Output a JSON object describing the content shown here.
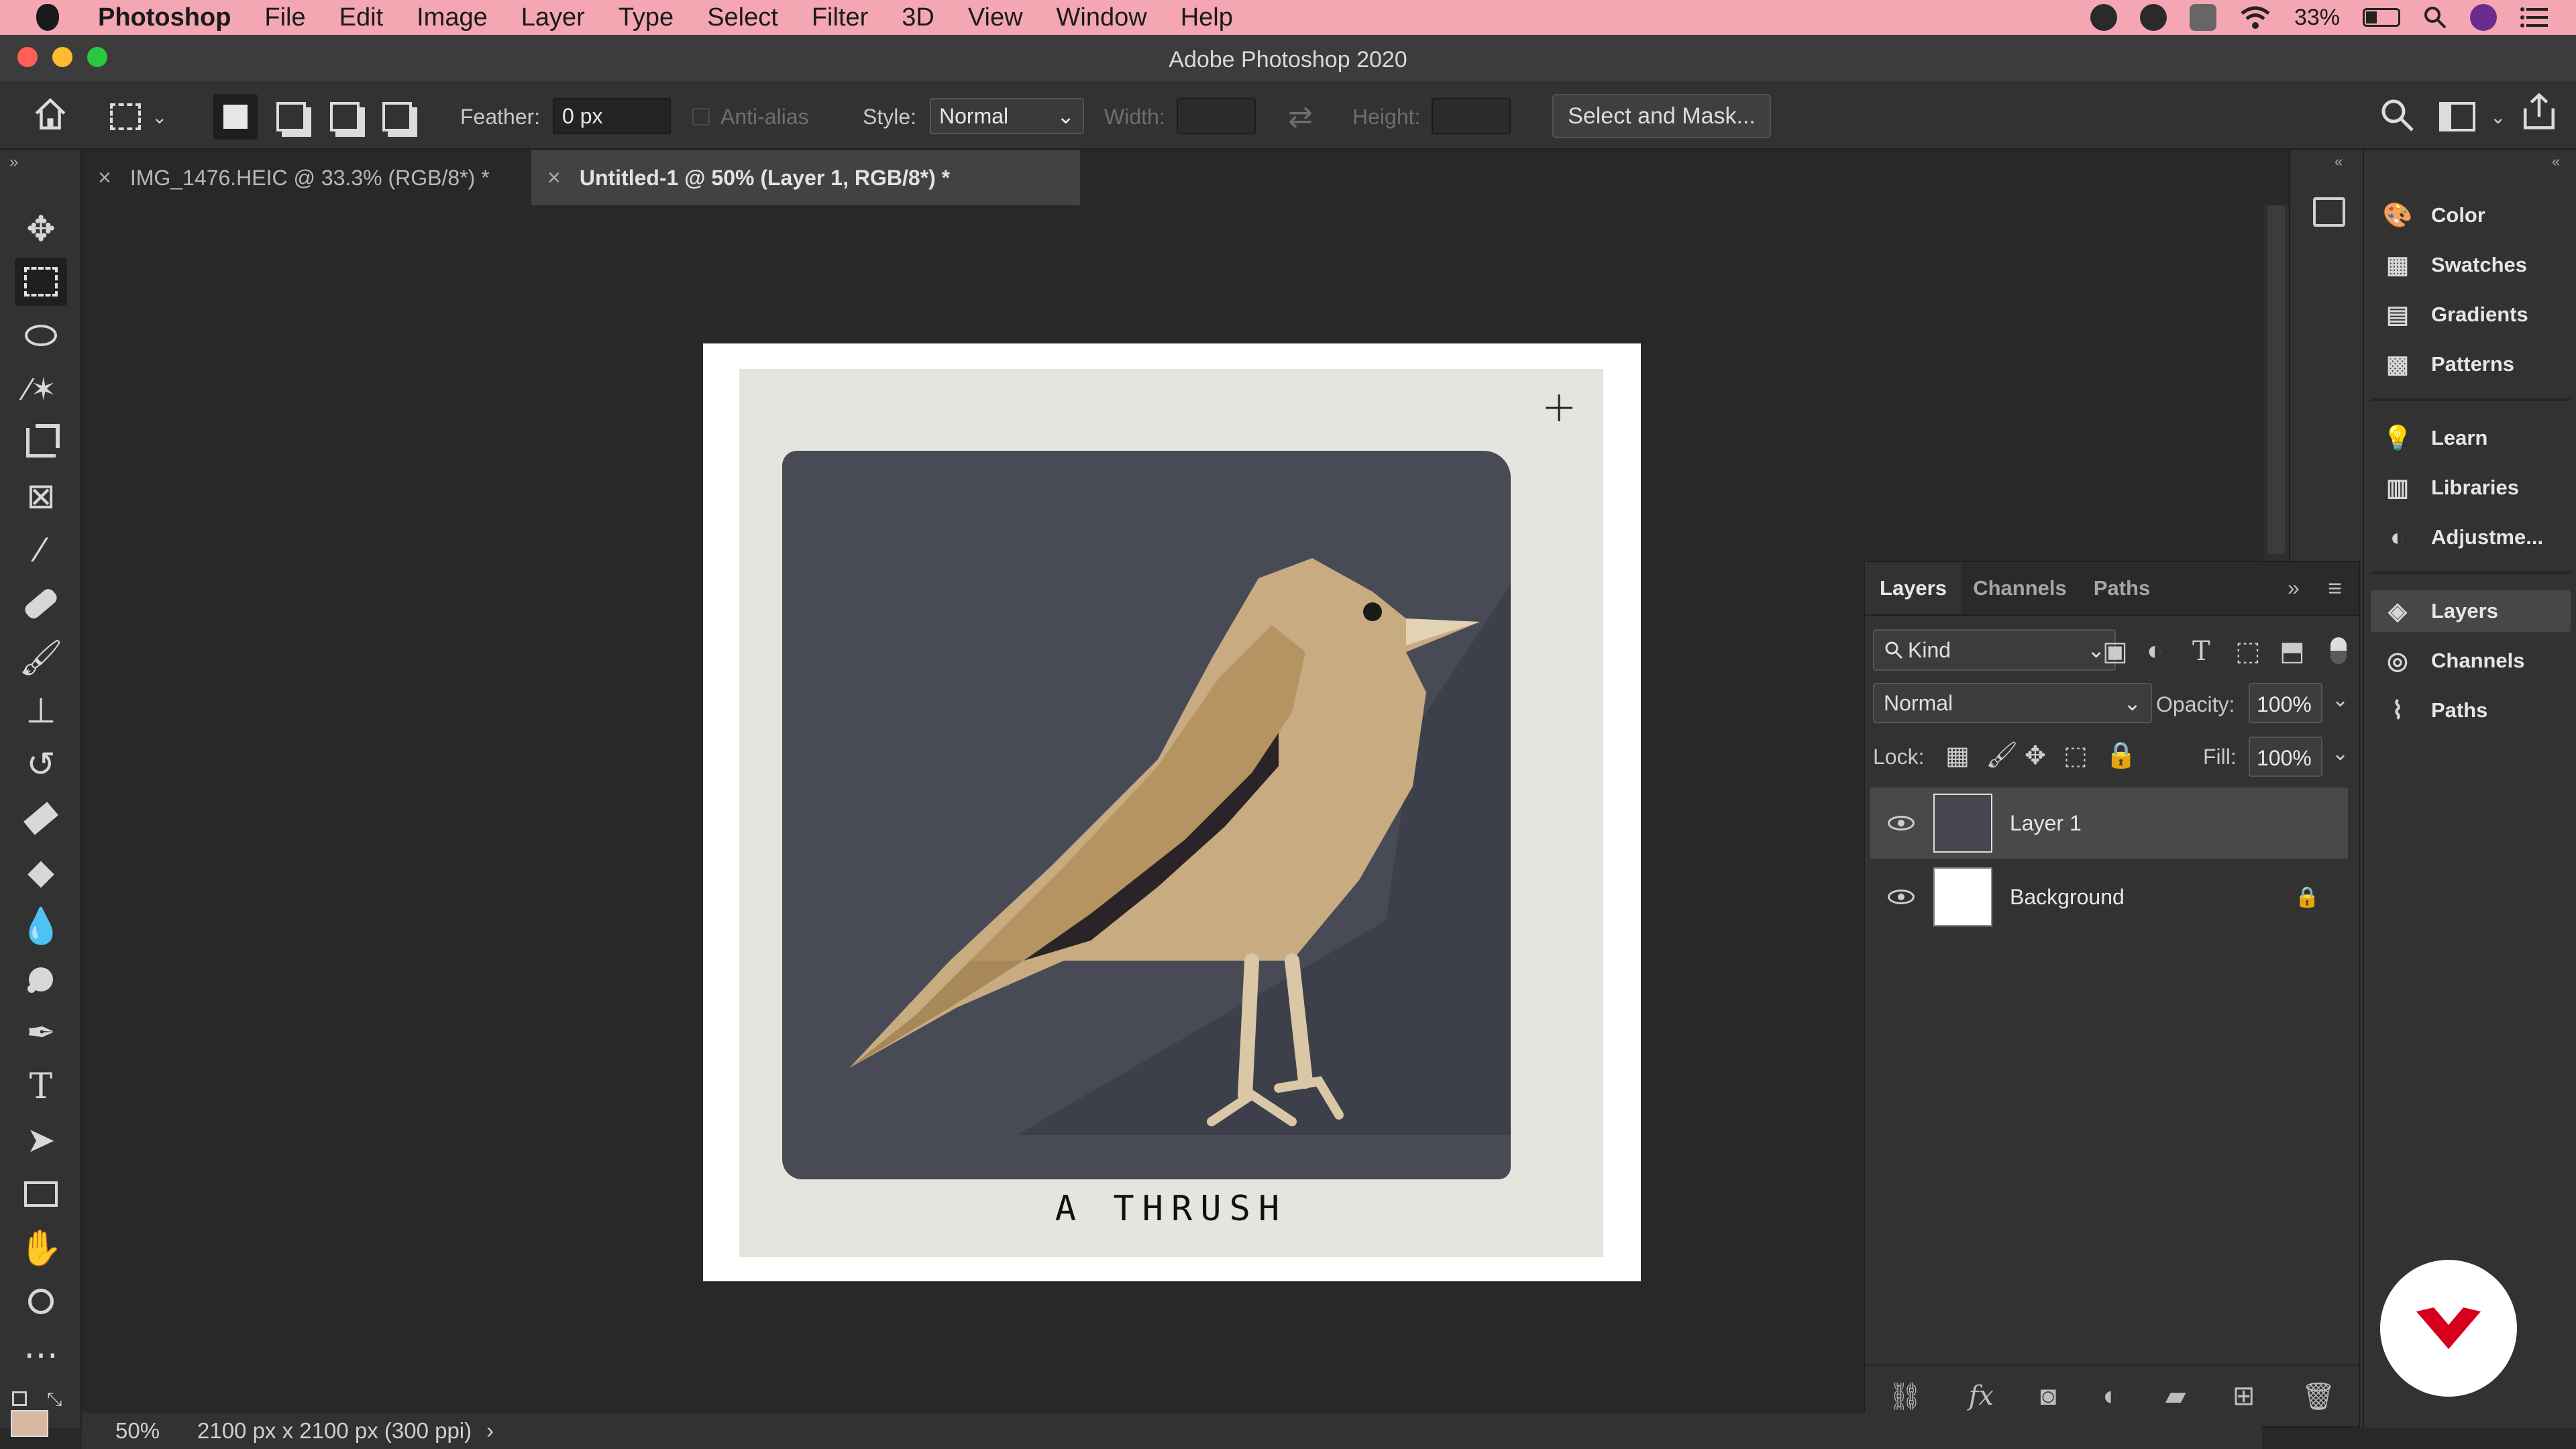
{
  "menubar": {
    "app_name": "Photoshop",
    "items": [
      "File",
      "Edit",
      "Image",
      "Layer",
      "Type",
      "Select",
      "Filter",
      "3D",
      "View",
      "Window",
      "Help"
    ],
    "battery": "33%"
  },
  "window": {
    "title": "Adobe Photoshop 2020"
  },
  "options": {
    "feather_label": "Feather:",
    "feather_value": "0 px",
    "antialias_label": "Anti-alias",
    "style_label": "Style:",
    "style_value": "Normal",
    "width_label": "Width:",
    "height_label": "Height:",
    "select_mask_label": "Select and Mask..."
  },
  "tabs": [
    {
      "label": "IMG_1476.HEIC @ 33.3% (RGB/8*) *"
    },
    {
      "label": "Untitled-1 @ 50% (Layer 1, RGB/8*) *"
    }
  ],
  "canvas": {
    "caption": "A THRUSH"
  },
  "right_panel": {
    "items": [
      "Color",
      "Swatches",
      "Gradients",
      "Patterns",
      "Learn",
      "Libraries",
      "Adjustme...",
      "Layers",
      "Channels",
      "Paths"
    ]
  },
  "layers_panel": {
    "tabs": [
      "Layers",
      "Channels",
      "Paths"
    ],
    "filter_kind": "Kind",
    "blend_mode": "Normal",
    "opacity_label": "Opacity:",
    "opacity_value": "100%",
    "lock_label": "Lock:",
    "fill_label": "Fill:",
    "fill_value": "100%",
    "layers": [
      {
        "name": "Layer 1"
      },
      {
        "name": "Background"
      }
    ]
  },
  "status": {
    "zoom": "50%",
    "doc_info": "2100 px x 2100 px (300 ppi)"
  },
  "colors": {
    "menubar_bg": "#f4a6b3",
    "canvas_bg": "#282828",
    "panel_bg": "#323232",
    "brand_red": "#d6001c"
  }
}
